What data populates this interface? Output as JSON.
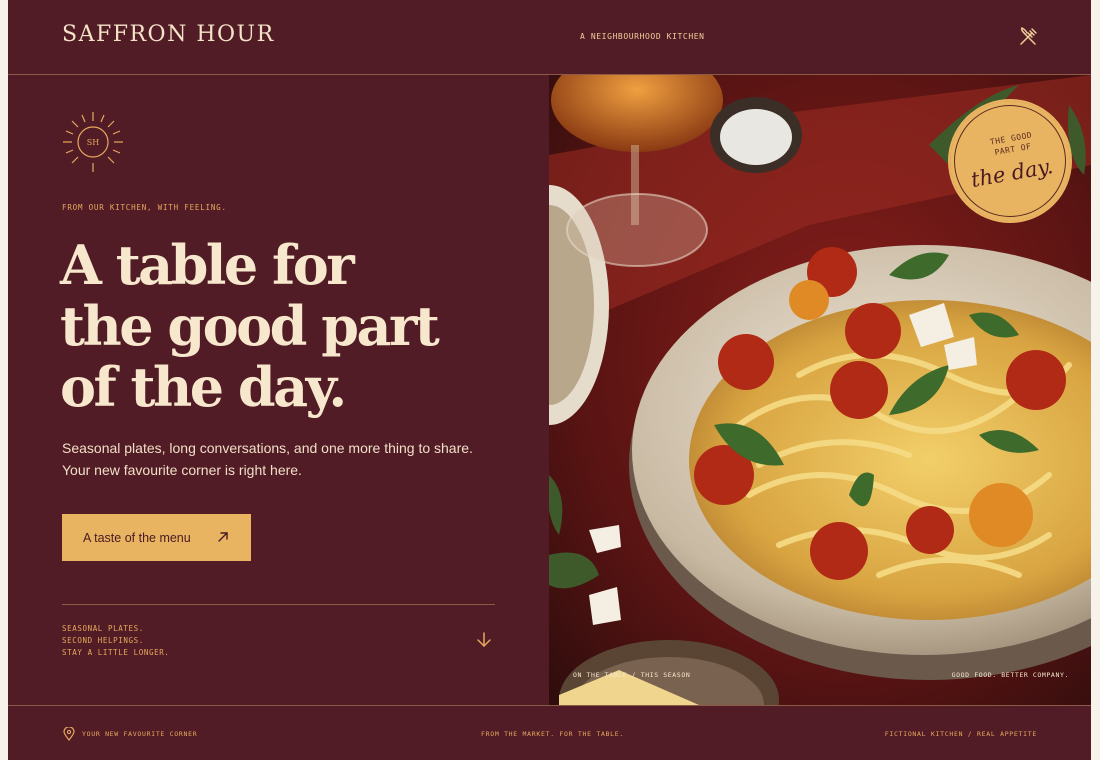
{
  "header": {
    "brand": "SAFFRON HOUR",
    "tagline": "A NEIGHBOURHOOD KITCHEN",
    "menu_icon": "fork-knife-icon"
  },
  "hero": {
    "logo_initials": "SH",
    "eyebrow": "FROM OUR KITCHEN, WITH FEELING.",
    "headline": [
      "A table for",
      "the good part",
      "of the day."
    ],
    "lede": "Seasonal plates, long conversations, and one more thing to share. Your new favourite corner is right here.",
    "cta_label": "A taste of the menu",
    "notes": [
      "SEASONAL PLATES.",
      "SECOND HELPINGS.",
      "STAY A LITTLE LONGER."
    ]
  },
  "photo": {
    "badge_small": [
      "THE GOOD",
      "PART OF"
    ],
    "badge_big": "the day.",
    "caption_left": "ON THE TABLE / THIS SEASON",
    "caption_right": "GOOD FOOD. BETTER COMPANY."
  },
  "footer": {
    "left": "YOUR NEW FAVOURITE CORNER",
    "middle": "FROM THE MARKET. FOR THE TABLE.",
    "right": "FICTIONAL KITCHEN / REAL APPETITE"
  },
  "colors": {
    "background": "#521c27",
    "accent": "#e9b461",
    "text_light": "#f7e7cc",
    "muted_accent": "#e6a85c"
  }
}
